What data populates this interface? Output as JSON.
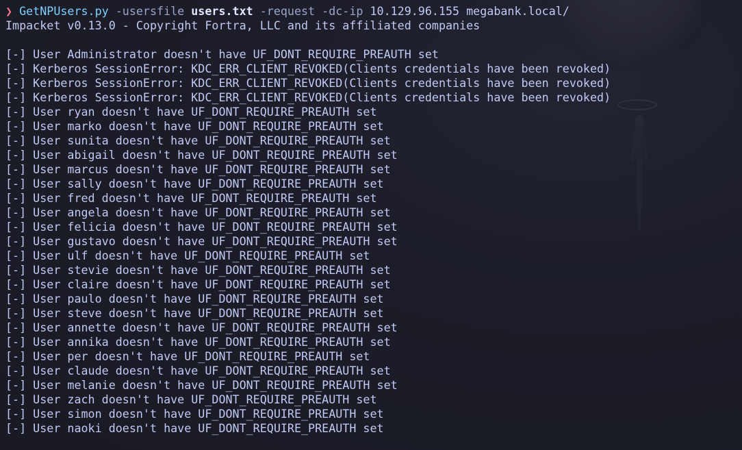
{
  "prompt": {
    "symbol": "❯",
    "command": "GetNPUsers.py",
    "flag_usersfile": "-usersfile",
    "usersfile_value": "users.txt",
    "flag_request": "-request",
    "flag_dcip": "-dc-ip",
    "dcip_value": "10.129.96.155",
    "target": "megabank.local/"
  },
  "banner": "Impacket v0.13.0 - Copyright Fortra, LLC and its affiliated companies",
  "output_lines": [
    "[-] User Administrator doesn't have UF_DONT_REQUIRE_PREAUTH set",
    "[-] Kerberos SessionError: KDC_ERR_CLIENT_REVOKED(Clients credentials have been revoked)",
    "[-] Kerberos SessionError: KDC_ERR_CLIENT_REVOKED(Clients credentials have been revoked)",
    "[-] Kerberos SessionError: KDC_ERR_CLIENT_REVOKED(Clients credentials have been revoked)",
    "[-] User ryan doesn't have UF_DONT_REQUIRE_PREAUTH set",
    "[-] User marko doesn't have UF_DONT_REQUIRE_PREAUTH set",
    "[-] User sunita doesn't have UF_DONT_REQUIRE_PREAUTH set",
    "[-] User abigail doesn't have UF_DONT_REQUIRE_PREAUTH set",
    "[-] User marcus doesn't have UF_DONT_REQUIRE_PREAUTH set",
    "[-] User sally doesn't have UF_DONT_REQUIRE_PREAUTH set",
    "[-] User fred doesn't have UF_DONT_REQUIRE_PREAUTH set",
    "[-] User angela doesn't have UF_DONT_REQUIRE_PREAUTH set",
    "[-] User felicia doesn't have UF_DONT_REQUIRE_PREAUTH set",
    "[-] User gustavo doesn't have UF_DONT_REQUIRE_PREAUTH set",
    "[-] User ulf doesn't have UF_DONT_REQUIRE_PREAUTH set",
    "[-] User stevie doesn't have UF_DONT_REQUIRE_PREAUTH set",
    "[-] User claire doesn't have UF_DONT_REQUIRE_PREAUTH set",
    "[-] User paulo doesn't have UF_DONT_REQUIRE_PREAUTH set",
    "[-] User steve doesn't have UF_DONT_REQUIRE_PREAUTH set",
    "[-] User annette doesn't have UF_DONT_REQUIRE_PREAUTH set",
    "[-] User annika doesn't have UF_DONT_REQUIRE_PREAUTH set",
    "[-] User per doesn't have UF_DONT_REQUIRE_PREAUTH set",
    "[-] User claude doesn't have UF_DONT_REQUIRE_PREAUTH set",
    "[-] User melanie doesn't have UF_DONT_REQUIRE_PREAUTH set",
    "[-] User zach doesn't have UF_DONT_REQUIRE_PREAUTH set",
    "[-] User simon doesn't have UF_DONT_REQUIRE_PREAUTH set",
    "[-] User naoki doesn't have UF_DONT_REQUIRE_PREAUTH set"
  ],
  "colors": {
    "background": "#1a1b26",
    "text": "#c0caf5",
    "prompt_arrow": "#f7768e",
    "command": "#7dcfff"
  }
}
